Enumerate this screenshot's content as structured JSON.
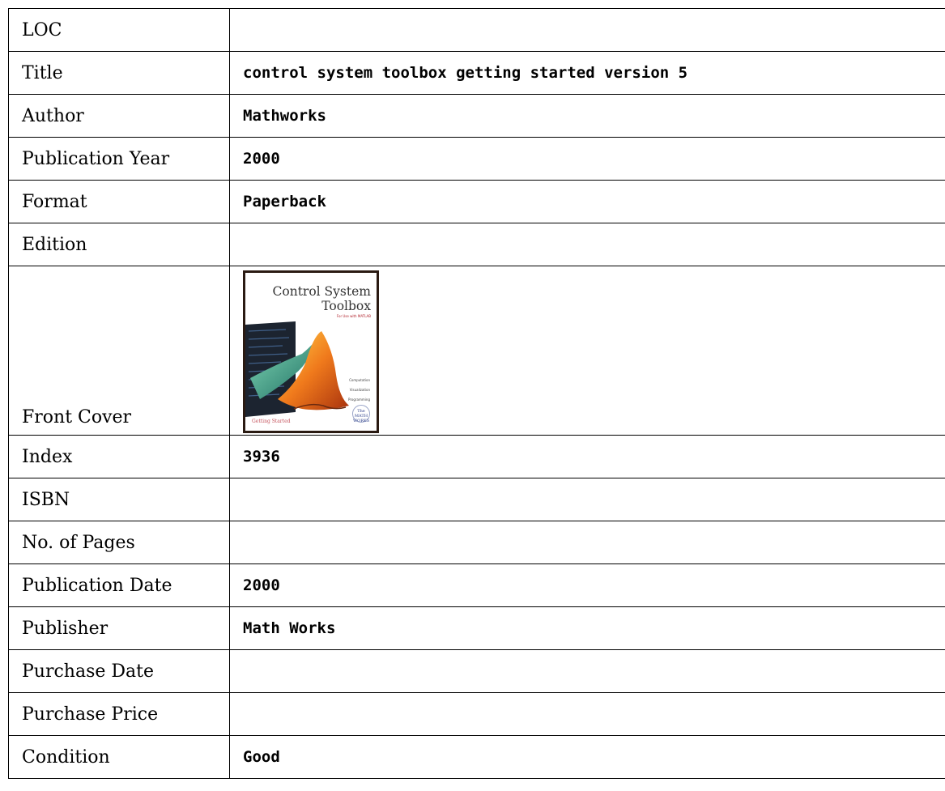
{
  "rows": [
    {
      "label": "LOC",
      "value": ""
    },
    {
      "label": "Title",
      "value": "control system toolbox getting started version 5"
    },
    {
      "label": "Author",
      "value": "Mathworks"
    },
    {
      "label": "Publication Year",
      "value": "2000"
    },
    {
      "label": "Format",
      "value": "Paperback"
    },
    {
      "label": "Edition",
      "value": ""
    },
    {
      "label": "Front Cover",
      "value": ""
    },
    {
      "label": "Index",
      "value": "3936"
    },
    {
      "label": "ISBN",
      "value": ""
    },
    {
      "label": "No. of Pages",
      "value": ""
    },
    {
      "label": "Publication Date",
      "value": "2000"
    },
    {
      "label": "Publisher",
      "value": "Math Works"
    },
    {
      "label": "Purchase Date",
      "value": ""
    },
    {
      "label": "Purchase Price",
      "value": ""
    },
    {
      "label": "Condition",
      "value": "Good"
    }
  ],
  "cover": {
    "title_line1": "Control System",
    "title_line2": "Toolbox",
    "subtitle": "For Use with MATLAB",
    "tags": [
      "Computation",
      "Visualization",
      "Programming"
    ],
    "bottom_text": "Getting Started",
    "logo_text": "The MATH WORKS",
    "colors": {
      "border": "#2a1a12",
      "surface_orange": "#f07a1c",
      "surface_teal": "#3fa58a",
      "panel_dark": "#1c2430"
    }
  }
}
